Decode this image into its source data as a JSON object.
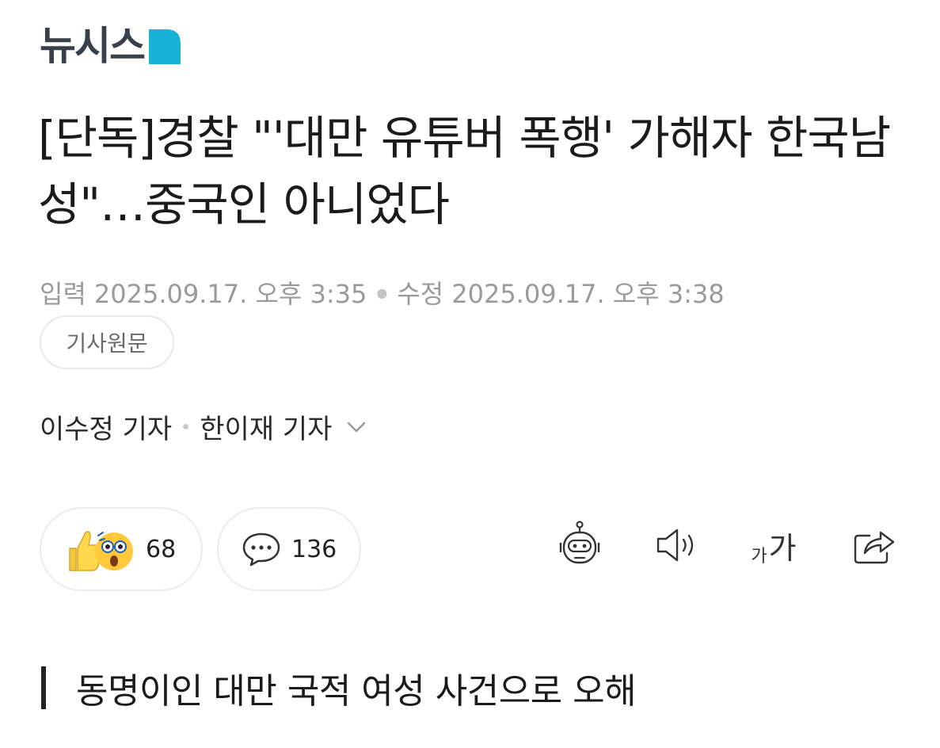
{
  "brand": {
    "name": "뉴시스",
    "mark_color": "#1ab1d6",
    "text_color": "#3a4049"
  },
  "article": {
    "title": "[단독]경찰 \"'대만 유튜버 폭행' 가해자 한국남성\"…중국인 아니었다",
    "input_label": "입력",
    "input_time": "2025.09.17. 오후 3:35",
    "edit_label": "수정",
    "edit_time": "2025.09.17. 오후 3:38",
    "original_button": "기사원문",
    "reporters": [
      "이수정 기자",
      "한이재 기자"
    ],
    "subheading": "동명이인 대만 국적 여성 사건으로 오해"
  },
  "actions": {
    "reaction_count": "68",
    "comment_count": "136",
    "font_small": "가",
    "font_large": "가"
  },
  "icons": [
    "thumbs-up-icon",
    "surprised-face-icon",
    "comment-bubble-icon",
    "robot-summary-icon",
    "speaker-icon",
    "font-size-icon",
    "share-icon",
    "chevron-down-icon"
  ]
}
